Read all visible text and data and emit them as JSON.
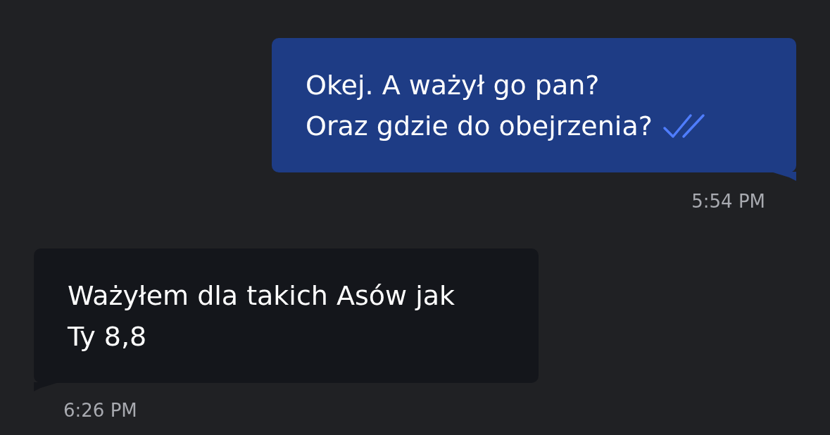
{
  "messages": [
    {
      "kind": "outgoing",
      "text": "Okej. A ważył go pan?\nOraz gdzie do obejrzenia?",
      "read": true,
      "time": "5:54 PM"
    },
    {
      "kind": "incoming",
      "text": "Ważyłem dla takich Asów jak Ty 8,8",
      "time": "6:26 PM"
    }
  ]
}
